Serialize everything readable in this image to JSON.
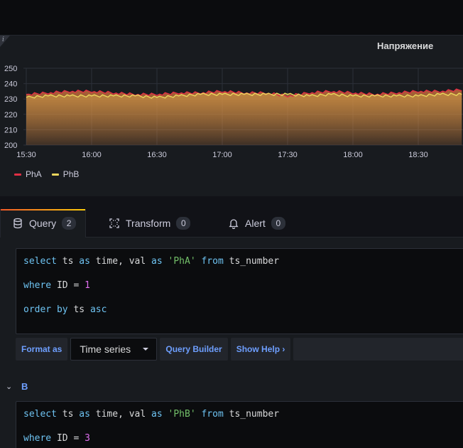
{
  "panel": {
    "title": "Напряжение",
    "info_icon": "info-icon"
  },
  "chart_data": {
    "type": "line",
    "title": "Напряжение",
    "x_ticks": [
      "15:30",
      "16:00",
      "16:30",
      "17:00",
      "17:30",
      "18:00",
      "18:30"
    ],
    "y_ticks": [
      200,
      210,
      220,
      230,
      240,
      250
    ],
    "ylim": [
      200,
      250
    ],
    "grid": true,
    "legend_position": "bottom-left",
    "series": [
      {
        "name": "PhA",
        "color": "#e02f44",
        "x": [
          "15:30",
          "15:40",
          "15:50",
          "16:00",
          "16:10",
          "16:20",
          "16:30",
          "16:40",
          "16:50",
          "17:00",
          "17:10",
          "17:20",
          "17:30",
          "17:40",
          "17:50",
          "18:00",
          "18:10",
          "18:20",
          "18:30",
          "18:40",
          "18:50"
        ],
        "values": [
          233,
          234,
          235,
          235,
          234,
          233,
          233,
          234,
          234,
          235,
          234,
          234,
          232,
          234,
          235,
          234,
          233,
          234,
          235,
          235,
          236
        ]
      },
      {
        "name": "PhB",
        "color": "#ead55c",
        "x": [
          "15:30",
          "15:40",
          "15:50",
          "16:00",
          "16:10",
          "16:20",
          "16:30",
          "16:40",
          "16:50",
          "17:00",
          "17:10",
          "17:20",
          "17:30",
          "17:40",
          "17:50",
          "18:00",
          "18:10",
          "18:20",
          "18:30",
          "18:40",
          "18:50"
        ],
        "values": [
          231,
          232,
          232,
          232,
          232,
          232,
          231,
          232,
          233,
          233,
          233,
          233,
          233,
          232,
          233,
          232,
          232,
          232,
          232,
          233,
          233
        ]
      }
    ]
  },
  "tabs": [
    {
      "label": "Query",
      "count": "2",
      "icon": "database-icon"
    },
    {
      "label": "Transform",
      "count": "0",
      "icon": "transform-icon"
    },
    {
      "label": "Alert",
      "count": "0",
      "icon": "bell-icon"
    }
  ],
  "query_a": {
    "lines": [
      [
        {
          "t": "select",
          "c": "kw"
        },
        {
          "t": " ts ",
          "c": ""
        },
        {
          "t": "as",
          "c": "kw"
        },
        {
          "t": " time, val ",
          "c": ""
        },
        {
          "t": "as",
          "c": "kw"
        },
        {
          "t": " ",
          "c": ""
        },
        {
          "t": "'PhA'",
          "c": "str"
        },
        {
          "t": " ",
          "c": ""
        },
        {
          "t": "from",
          "c": "kw"
        },
        {
          "t": " ts_number",
          "c": ""
        }
      ],
      [
        {
          "t": "where",
          "c": "kw"
        },
        {
          "t": " ID = ",
          "c": ""
        },
        {
          "t": "1",
          "c": "num"
        }
      ],
      [
        {
          "t": "order by",
          "c": "kw"
        },
        {
          "t": " ts ",
          "c": ""
        },
        {
          "t": "asc",
          "c": "kw"
        }
      ]
    ]
  },
  "toolbar": {
    "format_as_label": "Format as",
    "format_value": "Time series",
    "query_builder_label": "Query Builder",
    "show_help_label": "Show Help ›"
  },
  "query_b": {
    "name": "B",
    "lines": [
      [
        {
          "t": "select",
          "c": "kw"
        },
        {
          "t": " ts ",
          "c": ""
        },
        {
          "t": "as",
          "c": "kw"
        },
        {
          "t": " time, val ",
          "c": ""
        },
        {
          "t": "as",
          "c": "kw"
        },
        {
          "t": " ",
          "c": ""
        },
        {
          "t": "'PhB'",
          "c": "str"
        },
        {
          "t": " ",
          "c": ""
        },
        {
          "t": "from",
          "c": "kw"
        },
        {
          "t": " ts_number",
          "c": ""
        }
      ],
      [
        {
          "t": "where",
          "c": "kw"
        },
        {
          "t": " ID = ",
          "c": ""
        },
        {
          "t": "3",
          "c": "num"
        }
      ]
    ]
  }
}
